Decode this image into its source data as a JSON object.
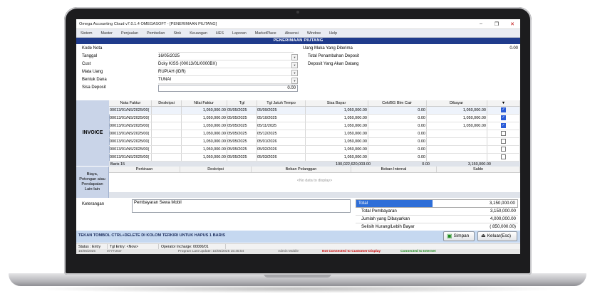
{
  "window": {
    "title": "Omega Accounting Cloud v7.0.1.4 OMEGASOFT - [PENERIMAAN PIUTANG]",
    "buttons": [
      "–",
      "❐",
      "✕"
    ]
  },
  "menu": [
    "Sistem",
    "Master",
    "Penjualan",
    "Pembelian",
    "Stok",
    "Keuangan",
    "HES",
    "Laporan",
    "MarketPlace",
    "Absensi",
    "Window",
    "Help"
  ],
  "form_title": "PENERIMAAN PIUTANG",
  "header": {
    "kode_nota_label": "Kode Nota",
    "tanggal_label": "Tanggal",
    "tanggal_value": "16/05/2025",
    "cust_label": "Cust",
    "cust_value": "Dcky KISS (00013/01/0000BX)",
    "mata_uang_label": "Mata Uang",
    "mata_uang_value": "RUPIAH (IDR)",
    "bentuk_dana_label": "Bentuk Dana",
    "bentuk_dana_value": "TUNAI",
    "sisa_deposit_label": "Sisa Deposit",
    "sisa_deposit_value": "0.00",
    "uang_muka_label": "Uang Muka Yang Diterima",
    "uang_muka_value": "0.00",
    "total_penambahan_label": "Total Penambahan Deposit",
    "deposit_akan_datang_label": "Deposit Yang Akan Datang"
  },
  "invoice": {
    "section_label": "INVOICE",
    "columns": [
      "Nota Faktur",
      "Deskripsi",
      "Nilai Faktur",
      "Tgl",
      "Tgl Jatuh Tempo",
      "Sisa Bayar",
      "Cek/BG Blm Cair",
      "Dibayar",
      "▼"
    ],
    "rows": [
      {
        "nota": "00013/01/NS/2025/00(",
        "desk": "",
        "nilai": "1,050,000.00",
        "tgl": "05/05/2025",
        "jt": "05/09/2025",
        "sisa": "1,050,000.00",
        "cek": "0.00",
        "dibayar": "1,050,000.00",
        "checked": true
      },
      {
        "nota": "00013/01/NS/2025/00(",
        "desk": "",
        "nilai": "1,050,000.00",
        "tgl": "05/05/2025",
        "jt": "05/10/2025",
        "sisa": "1,050,000.00",
        "cek": "0.00",
        "dibayar": "1,050,000.00",
        "checked": true
      },
      {
        "nota": "00013/01/NS/2025/00(",
        "desk": "",
        "nilai": "1,050,000.00",
        "tgl": "05/05/2025",
        "jt": "05/11/2025",
        "sisa": "1,050,000.00",
        "cek": "0.00",
        "dibayar": "1,050,000.00",
        "checked": true
      },
      {
        "nota": "00013/01/NS/2025/00(",
        "desk": "",
        "nilai": "1,050,000.00",
        "tgl": "05/05/2025",
        "jt": "05/12/2025",
        "sisa": "1,050,000.00",
        "cek": "0.00",
        "dibayar": "",
        "checked": false
      },
      {
        "nota": "00013/01/NS/2025/00(",
        "desk": "",
        "nilai": "1,050,000.00",
        "tgl": "05/05/2025",
        "jt": "05/01/2026",
        "sisa": "1,050,000.00",
        "cek": "0.00",
        "dibayar": "",
        "checked": false
      },
      {
        "nota": "00013/01/NS/2025/00(",
        "desk": "",
        "nilai": "1,050,000.00",
        "tgl": "05/05/2025",
        "jt": "05/02/2026",
        "sisa": "1,050,000.00",
        "cek": "0.00",
        "dibayar": "",
        "checked": false
      },
      {
        "nota": "00013/01/NS/2025/00(",
        "desk": "",
        "nilai": "1,050,000.00",
        "tgl": "05/05/2025",
        "jt": "05/03/2026",
        "sisa": "1,050,000.00",
        "cek": "0.00",
        "dibayar": "",
        "checked": false
      }
    ],
    "footer": {
      "baris": "Baris 15",
      "sisa_total": "100,022,620,003.00",
      "cek_total": "0.00",
      "dibayar_total": "3,150,000.00"
    }
  },
  "biaya": {
    "section_label": "Biaya, Potongan atau Pendapatan Lain-lain",
    "columns": [
      "Perkiraan",
      "Deskripsi",
      "Beban Pelanggan",
      "Beban Internal",
      "Saldo"
    ],
    "empty_text": "<No data to display>"
  },
  "keterangan": {
    "label": "Keterangan",
    "value": "Pembayaran Sewa Mobil"
  },
  "summary": [
    {
      "label": "Total",
      "value": "3,150,000.00"
    },
    {
      "label": "Total Pembayaran",
      "value": "3,150,000.00"
    },
    {
      "label": "Jumlah yang Dibayarkan",
      "value": "4,000,000.00"
    },
    {
      "label": "Selisih Kurang/Lebih Bayar",
      "value": "( 850,000.00)"
    }
  ],
  "hint": "TEKAN TOMBOL CTRL+DELETE DI KOLOM TERKIRI UNTUK HAPUS 1 BARIS",
  "buttons": {
    "simpan": "Simpan",
    "keluar": "Keluar(Esc)"
  },
  "status": {
    "status_entry": "Status : Entry",
    "tgl_entry": "Tgl Entry: <Now>",
    "operator": "Operator Incharge: 00000/01",
    "date": "16/05/2025",
    "user": "0777User",
    "program_update": "Program Last Update: 15/05/2025 15:45:54",
    "admin": "Admin Mobile",
    "customer_display": "Not Connected to Customer Display",
    "internet": "Connected to Internet"
  },
  "colors": {
    "form_title_bg": "#1f3b8c",
    "summary_highlight": "#2e6ed8",
    "hint_bar": "#c5d8f0",
    "red_status": "#cc0000",
    "green_status": "#1a8a1a"
  }
}
